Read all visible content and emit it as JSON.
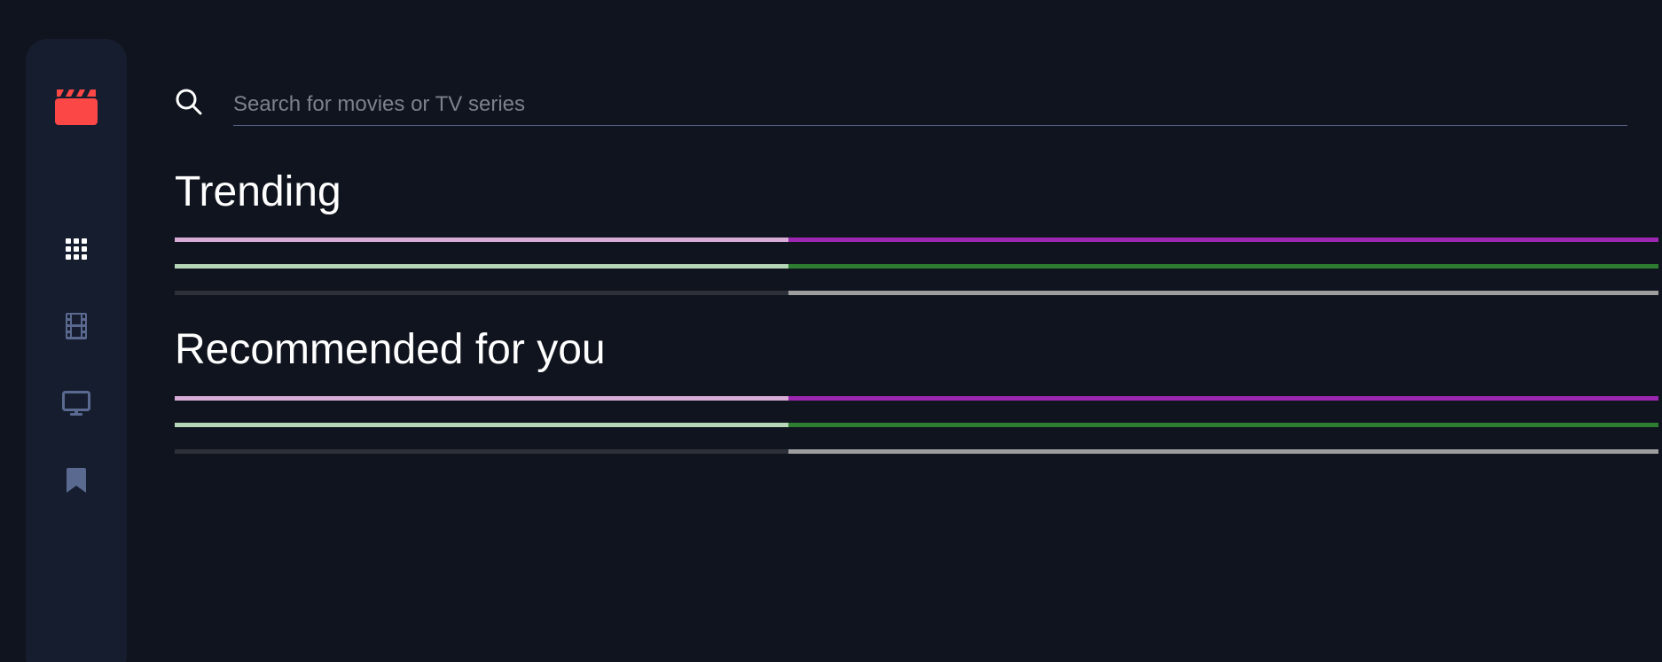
{
  "colors": {
    "background": "#10141e",
    "sidebar": "#161d2f",
    "logo": "#fc4747",
    "nav_icon": "#5a698f",
    "nav_icon_active": "#ffffff",
    "text": "#ffffff",
    "placeholder": "#7d818c",
    "search_underline": "#5a698f"
  },
  "sidebar": {
    "logo_icon": "clapperboard-icon",
    "items": [
      {
        "icon": "grid-icon",
        "active": true
      },
      {
        "icon": "film-icon",
        "active": false
      },
      {
        "icon": "tv-icon",
        "active": false
      },
      {
        "icon": "bookmark-icon",
        "active": false
      }
    ]
  },
  "search": {
    "placeholder": "Search for movies or TV series",
    "value": "",
    "icon": "search-icon"
  },
  "sections": [
    {
      "title": "Trending",
      "loading_bars": [
        {
          "left_color": "#d8acd6",
          "right_color": "#9c27b0"
        },
        {
          "left_color": "#b5d6b7",
          "right_color": "#2e7d32"
        },
        {
          "left_color": "#2d3039",
          "right_color": "#9e9e9e"
        }
      ]
    },
    {
      "title": "Recommended for you",
      "loading_bars": [
        {
          "left_color": "#d8acd6",
          "right_color": "#9c27b0"
        },
        {
          "left_color": "#b5d6b7",
          "right_color": "#2e7d32"
        },
        {
          "left_color": "#2d3039",
          "right_color": "#9e9e9e"
        }
      ]
    }
  ]
}
